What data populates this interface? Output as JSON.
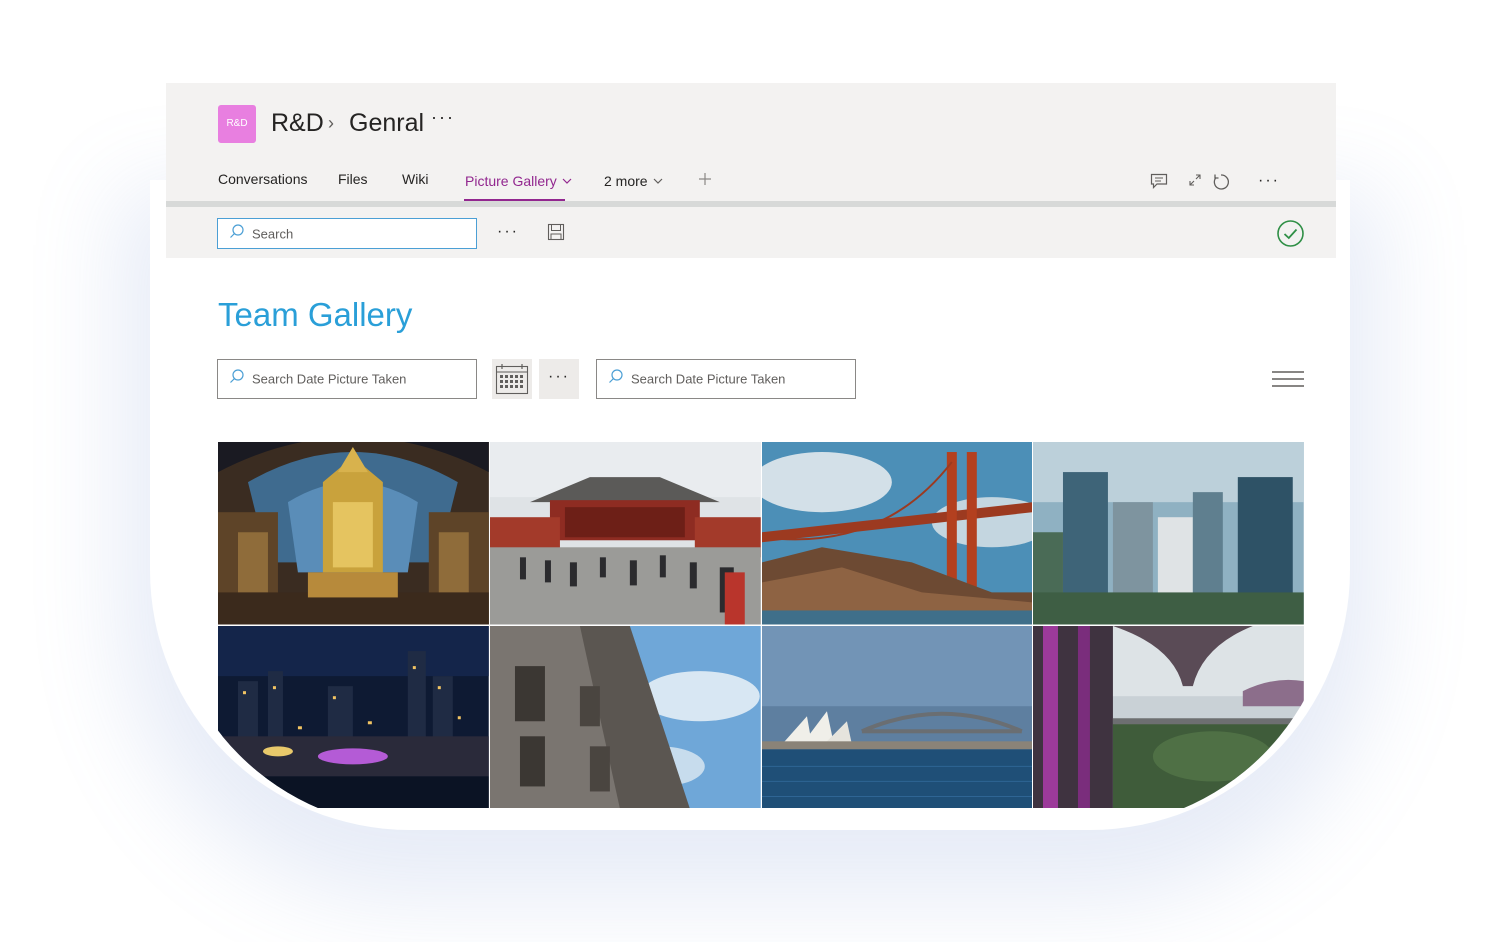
{
  "header": {
    "team_avatar": "R&D",
    "team_name": "R&D",
    "separator": "›",
    "channel_name": "Genral",
    "more": "···"
  },
  "tabs": [
    {
      "label": "Conversations",
      "active": false
    },
    {
      "label": "Files",
      "active": false
    },
    {
      "label": "Wiki",
      "active": false
    },
    {
      "label": "Picture Gallery",
      "active": true
    },
    {
      "label": "2 more",
      "active": false
    }
  ],
  "header_actions": [
    "chat-icon",
    "expand-icon",
    "refresh-icon",
    "more-icon"
  ],
  "toolbar": {
    "search_placeholder": "Search",
    "more": "···"
  },
  "gallery": {
    "title": "Team Gallery",
    "filter1_placeholder": "Search Date Picture Taken",
    "filter2_placeholder": "Search Date Picture Taken",
    "more": "···"
  },
  "photos": [
    "cathedral-interior",
    "temple-plaza",
    "golden-gate-bridge",
    "city-skyscrapers",
    "night-city-skyline",
    "baroque-facade",
    "sydney-opera-house",
    "supertree-grove"
  ],
  "colors": {
    "accent_purple": "#92278f",
    "title_blue": "#2a9fd8",
    "avatar_pink": "#e87fe0",
    "check_green": "#2f8f46"
  }
}
